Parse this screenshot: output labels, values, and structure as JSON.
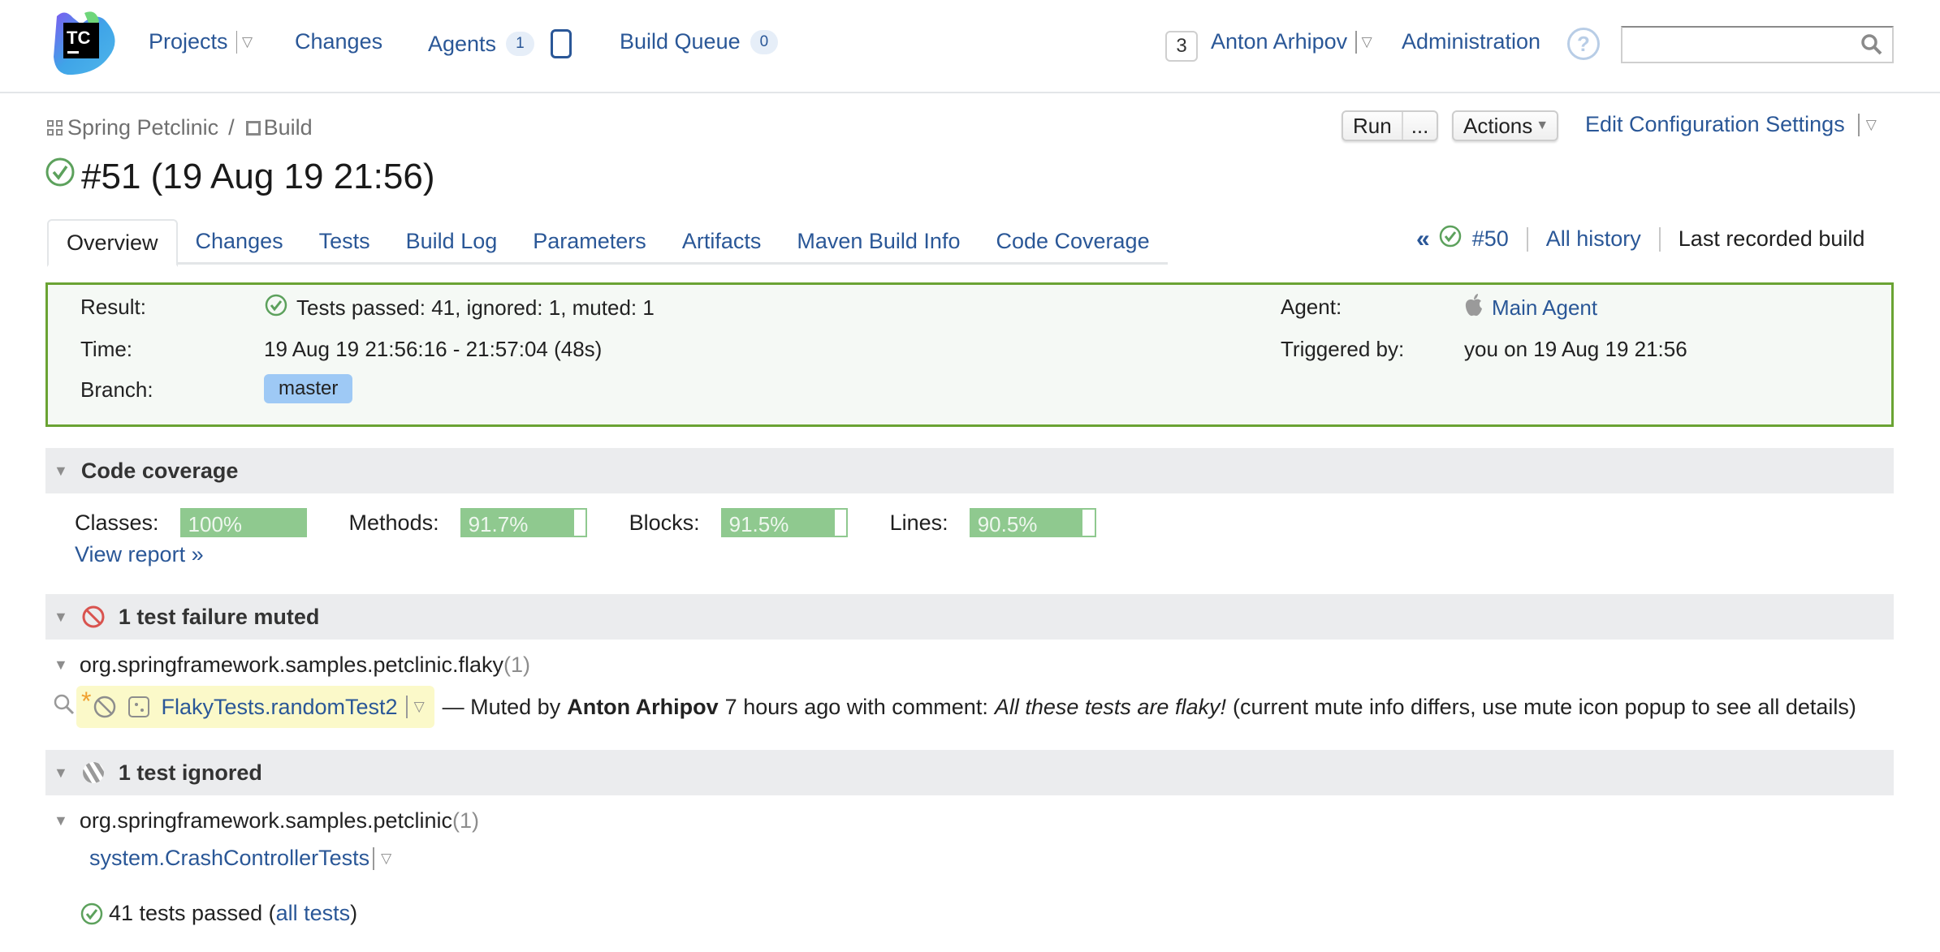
{
  "header": {
    "logo_text": "TC",
    "nav": {
      "projects": "Projects",
      "changes": "Changes",
      "agents": "Agents",
      "agents_count": "1",
      "build_queue": "Build Queue",
      "build_queue_count": "0"
    },
    "notifications_count": "3",
    "user": "Anton Arhipov",
    "administration": "Administration",
    "help": "?",
    "search": {
      "value": "",
      "placeholder": ""
    }
  },
  "breadcrumb": {
    "project": "Spring Petclinic",
    "separator": "/",
    "build_config": "Build"
  },
  "toolbar": {
    "run": "Run",
    "run_more": "...",
    "actions": "Actions",
    "edit_config": "Edit Configuration Settings"
  },
  "build": {
    "title": "#51 (19 Aug 19 21:56)",
    "status": "success"
  },
  "tabs": [
    {
      "label": "Overview",
      "active": true
    },
    {
      "label": "Changes"
    },
    {
      "label": "Tests"
    },
    {
      "label": "Build Log"
    },
    {
      "label": "Parameters"
    },
    {
      "label": "Artifacts"
    },
    {
      "label": "Maven Build Info"
    },
    {
      "label": "Code Coverage"
    }
  ],
  "history": {
    "prev_arrow": "«",
    "prev_build": "#50",
    "all_history": "All history",
    "last_recorded": "Last recorded build"
  },
  "result": {
    "result_label": "Result:",
    "result_value": "Tests passed: 41, ignored: 1, muted: 1",
    "time_label": "Time:",
    "time_value": "19 Aug 19 21:56:16 - 21:57:04 (48s)",
    "branch_label": "Branch:",
    "branch_value": "master",
    "agent_label": "Agent:",
    "agent_value": "Main Agent",
    "triggered_label": "Triggered by:",
    "triggered_value": "you on 19 Aug 19 21:56"
  },
  "coverage": {
    "title": "Code coverage",
    "items": [
      {
        "label": "Classes:",
        "value": "100%",
        "percent": 100
      },
      {
        "label": "Methods:",
        "value": "91.7%",
        "percent": 91.7
      },
      {
        "label": "Blocks:",
        "value": "91.5%",
        "percent": 91.5
      },
      {
        "label": "Lines:",
        "value": "90.5%",
        "percent": 90.5
      }
    ],
    "view_report": "View report »"
  },
  "muted": {
    "title": "1 test failure muted",
    "package": "org.springframework.samples.petclinic.flaky",
    "package_count": "(1)",
    "test_name": "FlakyTests.randomTest2",
    "muted_prefix": "— Muted by",
    "muted_by": "Anton Arhipov",
    "muted_when": "7 hours ago with comment:",
    "comment": "All these tests are flaky!",
    "note": "(current mute info differs, use mute icon popup to see all details)"
  },
  "ignored": {
    "title": "1 test ignored",
    "package": "org.springframework.samples.petclinic",
    "package_count": "(1)",
    "test_name": "system.CrashControllerTests"
  },
  "passed": {
    "text": "41 tests passed (",
    "link": "all tests",
    "close": ")"
  },
  "colors": {
    "link": "#2a5797",
    "success": "#5ca15c",
    "result_border": "#6aa333",
    "coverage_fill": "#8fc98f",
    "branch_bg": "#9ec9f5",
    "muted_bg": "#fbf9c9",
    "mute_icon": "#d9534f"
  }
}
